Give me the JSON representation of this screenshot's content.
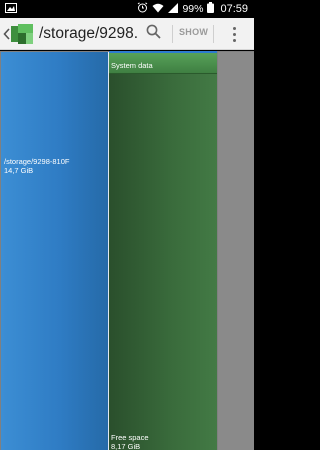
{
  "status_bar": {
    "battery_percent": "99%",
    "time": "07:59"
  },
  "action_bar": {
    "title": "/storage/9298...",
    "show_label": "SHOW"
  },
  "treemap": {
    "tiles": [
      {
        "name": "/storage/9298-810F",
        "size": "14,7 GiB",
        "color": "#2f7cc4"
      },
      {
        "name": "System data",
        "size": "",
        "color": "#4e9551"
      },
      {
        "name": "Free space",
        "size": "8,17 GiB",
        "color": "#3a6c3c"
      }
    ]
  },
  "colors": {
    "action_bar_bg": "#f2f2f2",
    "status_bar_bg": "#000000",
    "unused_area": "#808080"
  }
}
